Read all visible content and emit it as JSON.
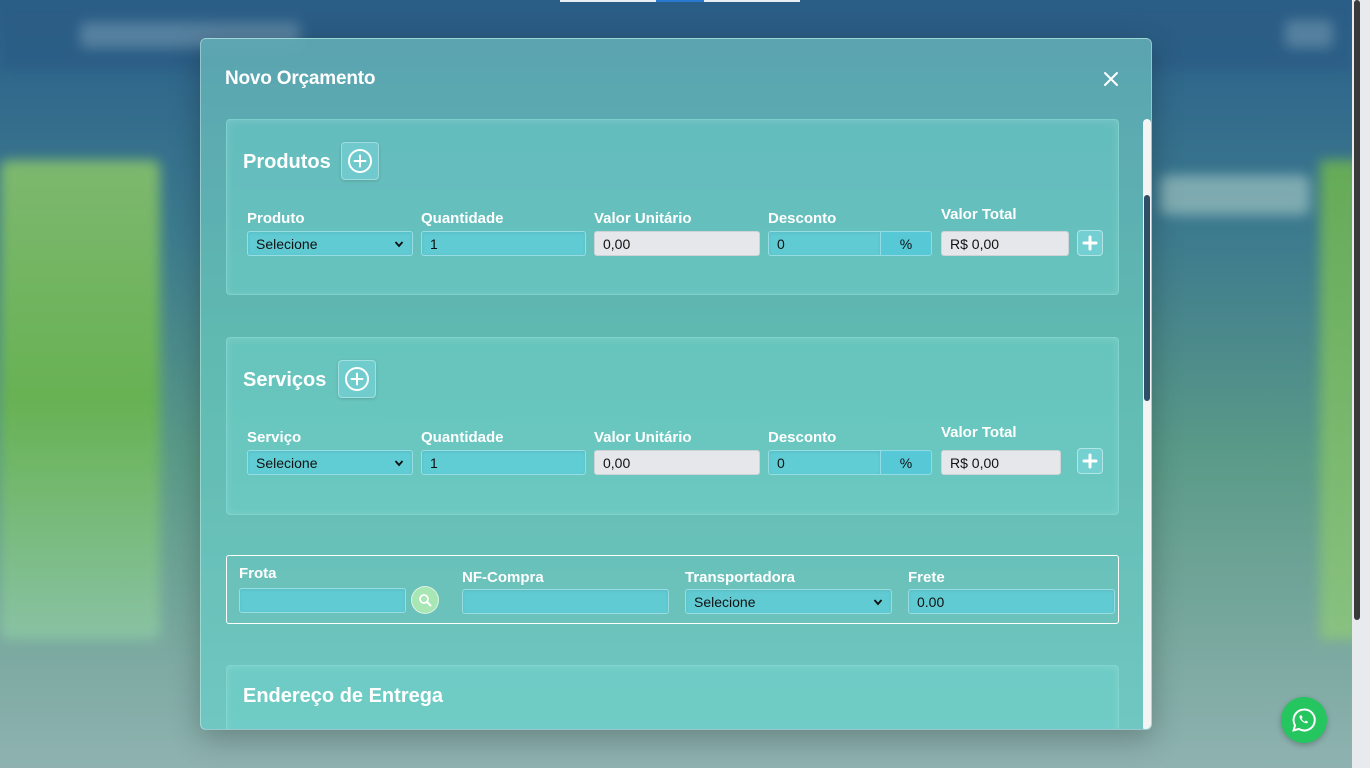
{
  "modal": {
    "title": "Novo Orçamento"
  },
  "products": {
    "title": "Produtos",
    "labels": {
      "item": "Produto",
      "quantity": "Quantidade",
      "unit_value": "Valor Unitário",
      "discount": "Desconto",
      "total": "Valor Total"
    },
    "row": {
      "item_selected": "Selecione",
      "quantity": "1",
      "unit_value": "0,00",
      "discount": "0",
      "discount_unit": "%",
      "total": "R$ 0,00"
    }
  },
  "services": {
    "title": "Serviços",
    "labels": {
      "item": "Serviço",
      "quantity": "Quantidade",
      "unit_value": "Valor Unitário",
      "discount": "Desconto",
      "total": "Valor Total"
    },
    "row": {
      "item_selected": "Selecione",
      "quantity": "1",
      "unit_value": "0,00",
      "discount": "0",
      "discount_unit": "%",
      "total": "R$ 0,00"
    }
  },
  "shipping": {
    "fleet_label": "Frota",
    "fleet_value": "",
    "invoice_label": "NF-Compra",
    "invoice_value": "",
    "carrier_label": "Transportadora",
    "carrier_selected": "Selecione",
    "freight_label": "Frete",
    "freight_value": "0.00"
  },
  "address": {
    "title": "Endereço de Entrega"
  },
  "icons": {
    "close": "close-icon",
    "add": "plus-circle-icon",
    "add_row": "plus-icon",
    "search": "search-icon",
    "whatsapp": "whatsapp-icon",
    "chevron": "chevron-down-icon"
  },
  "colors": {
    "accent_teal": "#5fcdd7",
    "search_button": "#a8e6b4",
    "whatsapp": "#25c560"
  }
}
